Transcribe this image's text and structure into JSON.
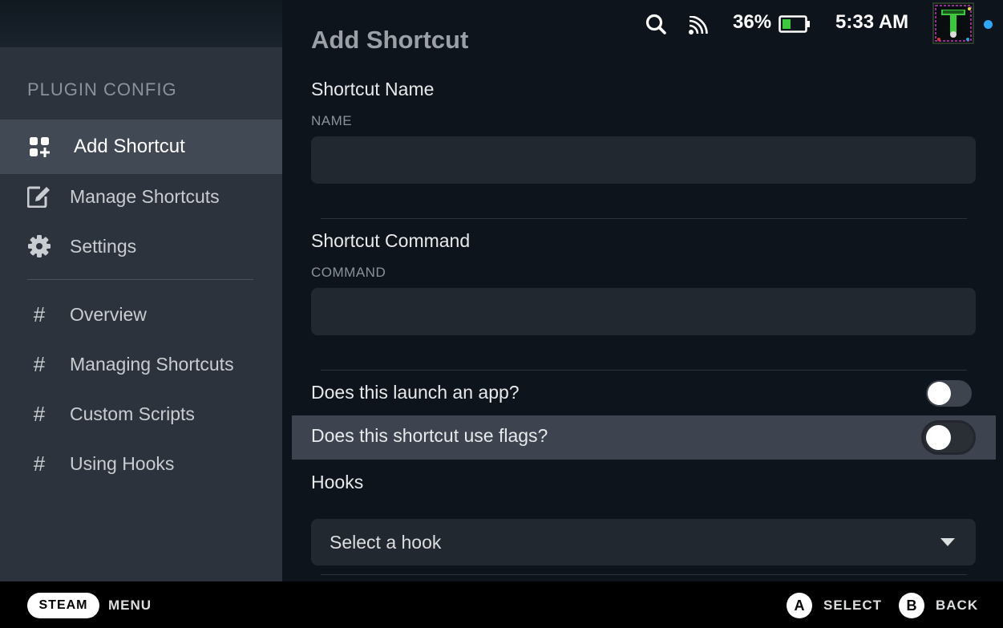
{
  "status_bar": {
    "battery_percent": "36%",
    "time": "5:33 AM",
    "icons": [
      "search-icon",
      "cast-icon",
      "battery-icon"
    ],
    "avatar_letter": "T"
  },
  "sidebar": {
    "title": "PLUGIN CONFIG",
    "items": [
      {
        "label": "Add Shortcut",
        "icon": "add-grid-icon",
        "active": true
      },
      {
        "label": "Manage Shortcuts",
        "icon": "edit-icon"
      },
      {
        "label": "Settings",
        "icon": "gear-icon"
      },
      {
        "label": "Overview",
        "icon": "hash-icon"
      },
      {
        "label": "Managing Shortcuts",
        "icon": "hash-icon"
      },
      {
        "label": "Custom Scripts",
        "icon": "hash-icon"
      },
      {
        "label": "Using Hooks",
        "icon": "hash-icon"
      }
    ]
  },
  "main": {
    "title": "Add Shortcut",
    "shortcut_name": {
      "heading": "Shortcut Name",
      "sublabel": "NAME",
      "value": ""
    },
    "shortcut_command": {
      "heading": "Shortcut Command",
      "sublabel": "COMMAND",
      "value": ""
    },
    "toggles": [
      {
        "label": "Does this launch an app?",
        "on": false
      },
      {
        "label": "Does this shortcut use flags?",
        "on": false
      }
    ],
    "hooks": {
      "heading": "Hooks",
      "selected": "Select a hook"
    }
  },
  "bottom_bar": {
    "steam_label": "STEAM",
    "menu_label": "MENU",
    "a_glyph": "A",
    "select_label": "SELECT",
    "b_glyph": "B",
    "back_label": "BACK"
  },
  "colors": {
    "accent_blue": "#2fa7ff",
    "battery_green": "#3ec83e"
  }
}
